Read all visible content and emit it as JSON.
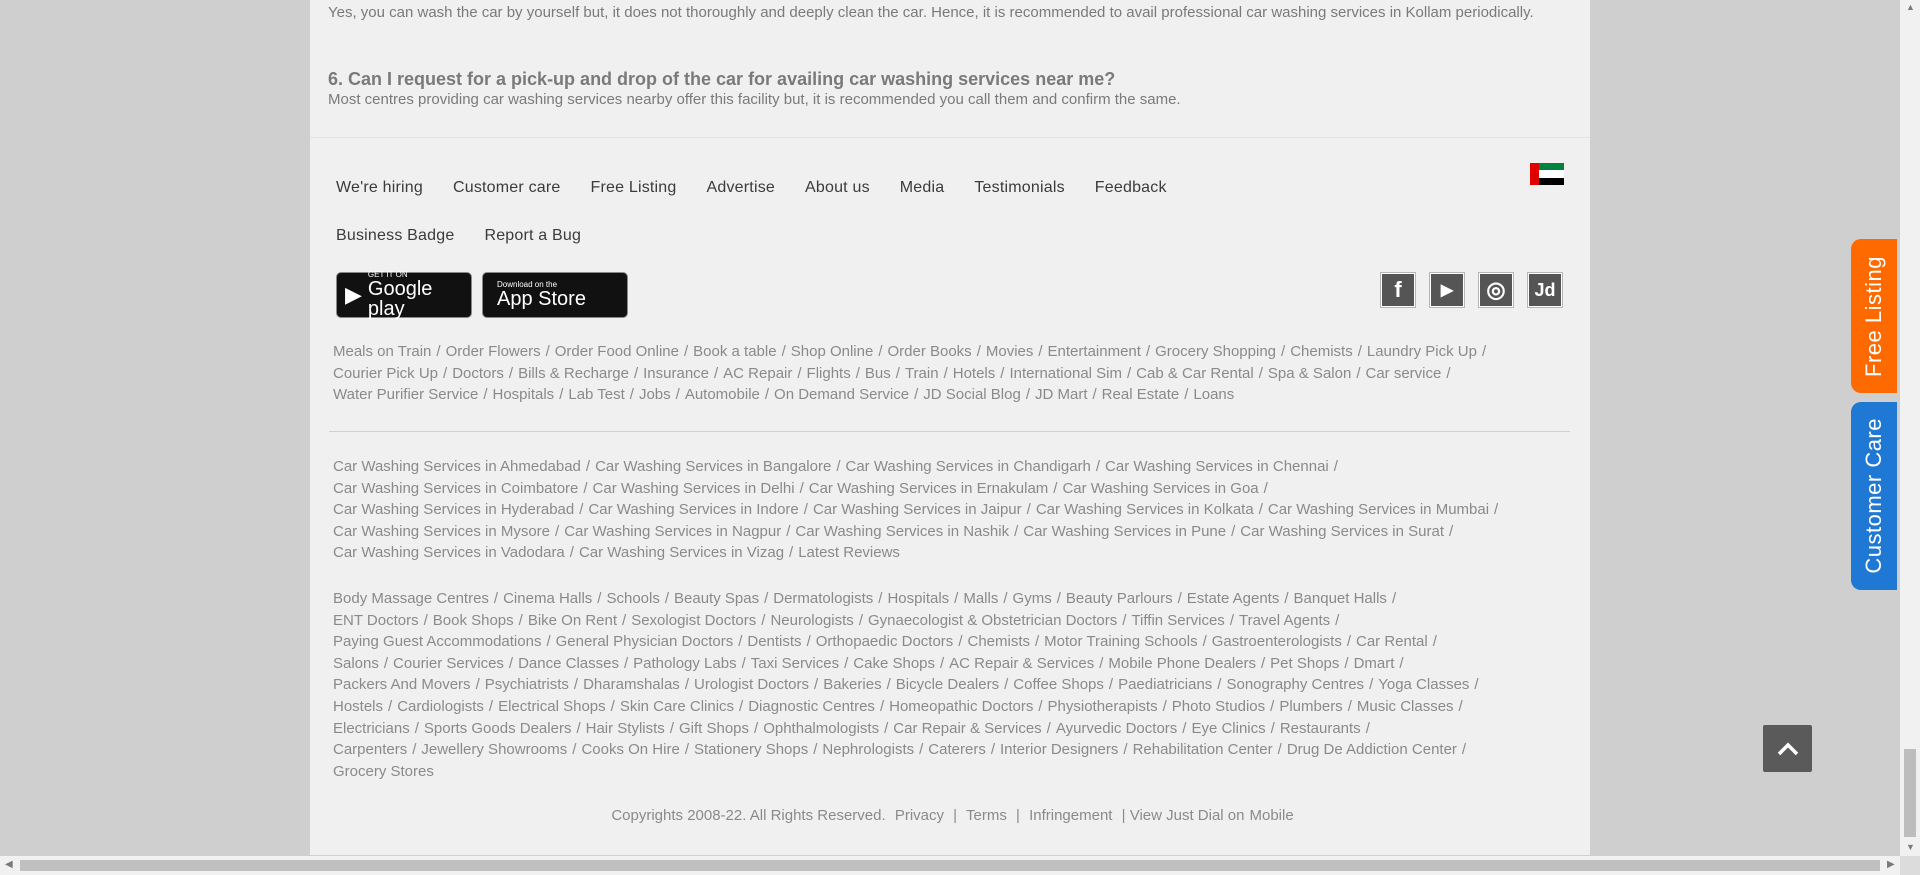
{
  "faq": {
    "answer_5": "Yes, you can wash the car by yourself but, it does not thoroughly and deeply clean the car. Hence, it is recommended to avail professional car washing services in Kollam periodically.",
    "question_6": "6. Can I request for a pick-up and drop of the car for availing car washing services near me?",
    "answer_6": "Most centres providing car washing services nearby offer this facility but, it is recommended you call them and confirm the same."
  },
  "nav": {
    "row1": [
      "We're hiring",
      "Customer care",
      "Free Listing",
      "Advertise",
      "About us",
      "Media",
      "Testimonials",
      "Feedback"
    ],
    "row2": [
      "Business Badge",
      "Report a Bug"
    ]
  },
  "flag": {
    "icon": "uae-flag-icon",
    "colors": [
      "#e00000",
      "#00843d",
      "#ffffff",
      "#000000"
    ]
  },
  "apps": {
    "google": {
      "small": "GET IT ON",
      "big": "Google play"
    },
    "apple": {
      "small": "Download on the",
      "big": "App Store"
    }
  },
  "social": [
    {
      "icon": "facebook-icon",
      "glyph": "f"
    },
    {
      "icon": "youtube-icon",
      "glyph": "▶"
    },
    {
      "icon": "instagram-icon",
      "glyph": "◎"
    },
    {
      "icon": "jd-blog-icon",
      "glyph": "Jd"
    }
  ],
  "services": [
    "Meals on Train",
    "Order Flowers",
    "Order Food Online",
    "Book a table",
    "Shop Online",
    "Order Books",
    "Movies",
    "Entertainment",
    "Grocery Shopping",
    "Chemists",
    "Laundry Pick Up",
    "Courier Pick Up",
    "Doctors",
    "Bills & Recharge",
    "Insurance",
    "AC Repair",
    "Flights",
    "Bus",
    "Train",
    "Hotels",
    "International Sim",
    "Cab & Car Rental",
    "Spa & Salon",
    "Car service",
    "Water Purifier Service",
    "Hospitals",
    "Lab Test",
    "Jobs",
    "Automobile",
    "On Demand Service",
    "JD Social Blog",
    "JD Mart",
    "Real Estate",
    "Loans"
  ],
  "cities": [
    "Car Washing Services in Ahmedabad",
    "Car Washing Services in Bangalore",
    "Car Washing Services in Chandigarh",
    "Car Washing Services in Chennai",
    "Car Washing Services in Coimbatore",
    "Car Washing Services in Delhi",
    "Car Washing Services in Ernakulam",
    "Car Washing Services in Goa",
    "Car Washing Services in Hyderabad",
    "Car Washing Services in Indore",
    "Car Washing Services in Jaipur",
    "Car Washing Services in Kolkata",
    "Car Washing Services in Mumbai",
    "Car Washing Services in Mysore",
    "Car Washing Services in Nagpur",
    "Car Washing Services in Nashik",
    "Car Washing Services in Pune",
    "Car Washing Services in Surat",
    "Car Washing Services in Vadodara",
    "Car Washing Services in Vizag",
    "Latest Reviews"
  ],
  "categories": [
    "Body Massage Centres",
    "Cinema Halls",
    "Schools",
    "Beauty Spas",
    "Dermatologists",
    "Hospitals",
    "Malls",
    "Gyms",
    "Beauty Parlours",
    "Estate Agents",
    "Banquet Halls",
    "ENT Doctors",
    "Book Shops",
    "Bike On Rent",
    "Sexologist Doctors",
    "Neurologists",
    "Gynaecologist & Obstetrician Doctors",
    "Tiffin Services",
    "Travel Agents",
    "Paying Guest Accommodations",
    "General Physician Doctors",
    "Dentists",
    "Orthopaedic Doctors",
    "Chemists",
    "Motor Training Schools",
    "Gastroenterologists",
    "Car Rental",
    "Salons",
    "Courier Services",
    "Dance Classes",
    "Pathology Labs",
    "Taxi Services",
    "Cake Shops",
    "AC Repair & Services",
    "Mobile Phone Dealers",
    "Pet Shops",
    "Dmart",
    "Packers And Movers",
    "Psychiatrists",
    "Dharamshalas",
    "Urologist Doctors",
    "Bakeries",
    "Bicycle Dealers",
    "Coffee Shops",
    "Paediatricians",
    "Sonography Centres",
    "Yoga Classes",
    "Hostels",
    "Cardiologists",
    "Electrical Shops",
    "Skin Care Clinics",
    "Diagnostic Centres",
    "Homeopathic Doctors",
    "Physiotherapists",
    "Photo Studios",
    "Plumbers",
    "Music Classes",
    "Electricians",
    "Sports Goods Dealers",
    "Hair Stylists",
    "Gift Shops",
    "Ophthalmologists",
    "Car Repair & Services",
    "Ayurvedic Doctors",
    "Eye Clinics",
    "Restaurants",
    "Carpenters",
    "Jewellery Showrooms",
    "Cooks On Hire",
    "Stationery Shops",
    "Nephrologists",
    "Caterers",
    "Interior Designers",
    "Rehabilitation Center",
    "Drug De Addiction Center",
    "Grocery Stores"
  ],
  "footer": {
    "copyright": "Copyrights 2008-22. All Rights Reserved.",
    "privacy": "Privacy",
    "terms": "Terms",
    "infringement": "Infringement",
    "view_prefix": "| View Just Dial on",
    "mobile": "Mobile"
  },
  "side_tabs": {
    "free_listing": "Free Listing",
    "customer_care": "Customer Care"
  },
  "colors": {
    "free_listing": "#ff6a00",
    "customer_care": "#1e78d4"
  }
}
